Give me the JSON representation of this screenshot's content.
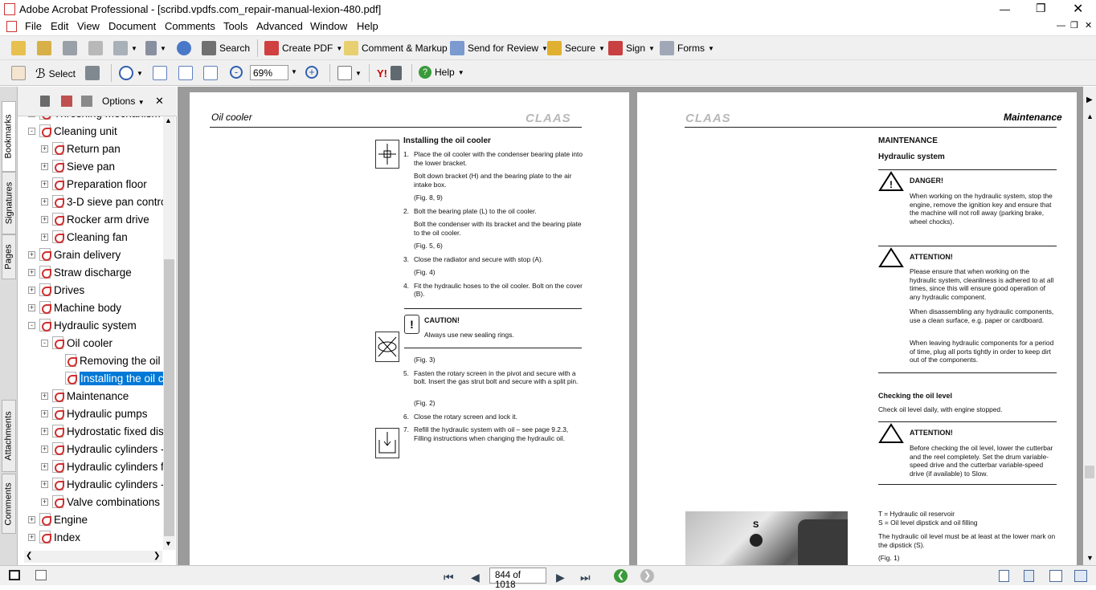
{
  "window": {
    "title": "Adobe Acrobat Professional - [scribd.vpdfs.com_repair-manual-lexion-480.pdf]"
  },
  "menu": [
    "File",
    "Edit",
    "View",
    "Document",
    "Comments",
    "Tools",
    "Advanced",
    "Window",
    "Help"
  ],
  "toolbar1": {
    "search": "Search",
    "create_pdf": "Create PDF",
    "comment_markup": "Comment & Markup",
    "send_review": "Send for Review",
    "secure": "Secure",
    "sign": "Sign",
    "forms": "Forms"
  },
  "toolbar2": {
    "select": "Select",
    "zoom": "69%",
    "help": "Help"
  },
  "sidetabs": [
    "Bookmarks",
    "Signatures",
    "Pages",
    "Attachments",
    "Comments"
  ],
  "bookmarks": {
    "options": "Options",
    "items": [
      {
        "label": "Threshing mechanism",
        "level": 1,
        "exp": "+"
      },
      {
        "label": "Cleaning unit",
        "level": 1,
        "exp": "-"
      },
      {
        "label": "Return pan",
        "level": 2,
        "exp": "+"
      },
      {
        "label": "Sieve pan",
        "level": 2,
        "exp": "+"
      },
      {
        "label": "Preparation floor",
        "level": 2,
        "exp": "+"
      },
      {
        "label": "3-D sieve pan contro",
        "level": 2,
        "exp": "+"
      },
      {
        "label": "Rocker arm drive",
        "level": 2,
        "exp": "+"
      },
      {
        "label": "Cleaning fan",
        "level": 2,
        "exp": "+"
      },
      {
        "label": "Grain delivery",
        "level": 1,
        "exp": "+"
      },
      {
        "label": "Straw discharge",
        "level": 1,
        "exp": "+"
      },
      {
        "label": "Drives",
        "level": 1,
        "exp": "+"
      },
      {
        "label": "Machine body",
        "level": 1,
        "exp": "+"
      },
      {
        "label": "Hydraulic system",
        "level": 1,
        "exp": "-"
      },
      {
        "label": "Oil cooler",
        "level": 2,
        "exp": "-"
      },
      {
        "label": "Removing the oil c",
        "level": 3,
        "exp": ""
      },
      {
        "label": "Installing the oil c",
        "level": 3,
        "exp": "",
        "selected": true
      },
      {
        "label": "Maintenance",
        "level": 2,
        "exp": "+"
      },
      {
        "label": "Hydraulic pumps",
        "level": 2,
        "exp": "+"
      },
      {
        "label": "Hydrostatic fixed dis",
        "level": 2,
        "exp": "+"
      },
      {
        "label": "Hydraulic cylinders -",
        "level": 2,
        "exp": "+"
      },
      {
        "label": "Hydraulic cylinders f",
        "level": 2,
        "exp": "+"
      },
      {
        "label": "Hydraulic cylinders -",
        "level": 2,
        "exp": "+"
      },
      {
        "label": "Valve combinations",
        "level": 2,
        "exp": "+"
      },
      {
        "label": "Engine",
        "level": 1,
        "exp": "+"
      },
      {
        "label": "Index",
        "level": 1,
        "exp": "+"
      }
    ]
  },
  "left_page": {
    "header": "Oil cooler",
    "brand": "CLAAS",
    "title": "Installing the oil cooler",
    "steps": [
      {
        "n": "1.",
        "text": "Place the oil cooler with the condenser bearing plate into the lower bracket."
      },
      {
        "n": "",
        "text": "Bolt down bracket (H) and the bearing plate to the air intake box."
      },
      {
        "n": "",
        "text": "(Fig. 8, 9)"
      },
      {
        "n": "2.",
        "text": "Bolt the bearing plate (L) to the oil cooler."
      },
      {
        "n": "",
        "text": "Bolt the condenser with its bracket and the bearing plate to the oil cooler."
      },
      {
        "n": "",
        "text": "(Fig. 5, 6)"
      },
      {
        "n": "3.",
        "text": "Close the radiator and secure with stop (A)."
      },
      {
        "n": "",
        "text": "(Fig. 4)"
      },
      {
        "n": "4.",
        "text": "Fit the hydraulic hoses to the oil cooler. Bolt on the cover (B)."
      }
    ],
    "caution_title": "CAUTION!",
    "caution_text": "Always use new sealing rings.",
    "steps2": [
      {
        "n": "",
        "text": "(Fig. 3)"
      },
      {
        "n": "5.",
        "text": "Fasten the rotary screen in the pivot and secure with a bolt. Insert the gas strut bolt and secure with a split pin."
      },
      {
        "n": "",
        "text": "(Fig. 2)"
      },
      {
        "n": "6.",
        "text": "Close the rotary screen and lock it."
      },
      {
        "n": "7.",
        "text": "Refill the hydraulic system with oil – see page 9.2.3, Filling instructions when changing the hydraulic oil."
      }
    ]
  },
  "right_page": {
    "header": "Maintenance",
    "brand": "CLAAS",
    "section": "MAINTENANCE",
    "subsection": "Hydraulic system",
    "danger_title": "DANGER!",
    "danger_text": "When working on the hydraulic system, stop the engine, remove the ignition key and ensure that the machine will not roll away (parking brake, wheel chocks).",
    "att1_title": "ATTENTION!",
    "att1_p1": "Please ensure that when working on the hydraulic system, cleanliness is adhered to at all times, since this will ensure good operation of any hydraulic component.",
    "att1_p2": "When disassembling any hydraulic components, use a clean surface, e.g. paper or cardboard.",
    "att1_p3": "When leaving hydraulic components for a period of time, plug all ports tightly in order to keep dirt out of the components.",
    "check_title": "Checking the oil level",
    "check_text": "Check oil level daily, with engine stopped.",
    "att2_title": "ATTENTION!",
    "att2_text": "Before checking the oil level, lower the cutterbar and the reel completely. Set the drum variable-speed drive and the cutterbar variable-speed drive (if available) to Slow.",
    "legend_t": "T  =  Hydraulic oil reservoir",
    "legend_s": "S  =  Oil level dipstick and oil filling",
    "level_text": "The hydraulic oil level must be at least at the lower mark on the dipstick (S).",
    "fig": "(Fig. 1)",
    "img_label": "S"
  },
  "status": {
    "page": "844 of 1018"
  }
}
